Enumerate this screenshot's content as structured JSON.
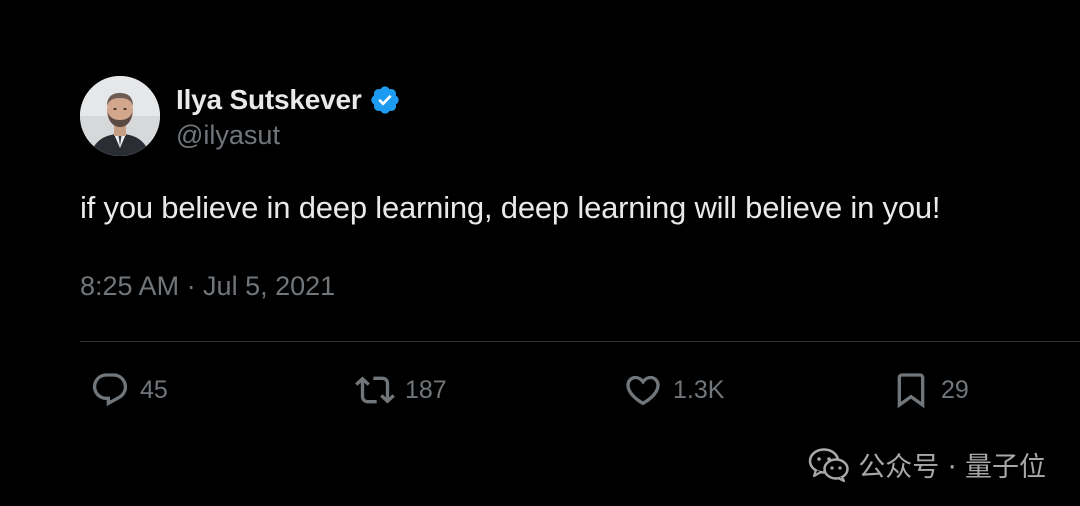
{
  "tweet": {
    "author": {
      "display_name": "Ilya Sutskever",
      "handle": "@ilyasut",
      "avatar_icon": "profile-photo",
      "verified_icon": "verified-badge-icon"
    },
    "text": "if you believe in deep learning, deep learning will believe in you!",
    "timestamp": "8:25 AM · Jul 5, 2021",
    "actions": {
      "reply": {
        "icon": "reply-icon",
        "count": "45"
      },
      "retweet": {
        "icon": "retweet-icon",
        "count": "187"
      },
      "like": {
        "icon": "heart-icon",
        "count": "1.3K"
      },
      "bookmark": {
        "icon": "bookmark-icon",
        "count": "29"
      }
    }
  },
  "watermark": {
    "icon": "wechat-icon",
    "text": "公众号 · 量子位"
  },
  "colors": {
    "background": "#000000",
    "primary_text": "#e7e9ea",
    "secondary_text": "#71767b",
    "divider": "#2f3336",
    "verified_blue": "#1d9bf0"
  }
}
